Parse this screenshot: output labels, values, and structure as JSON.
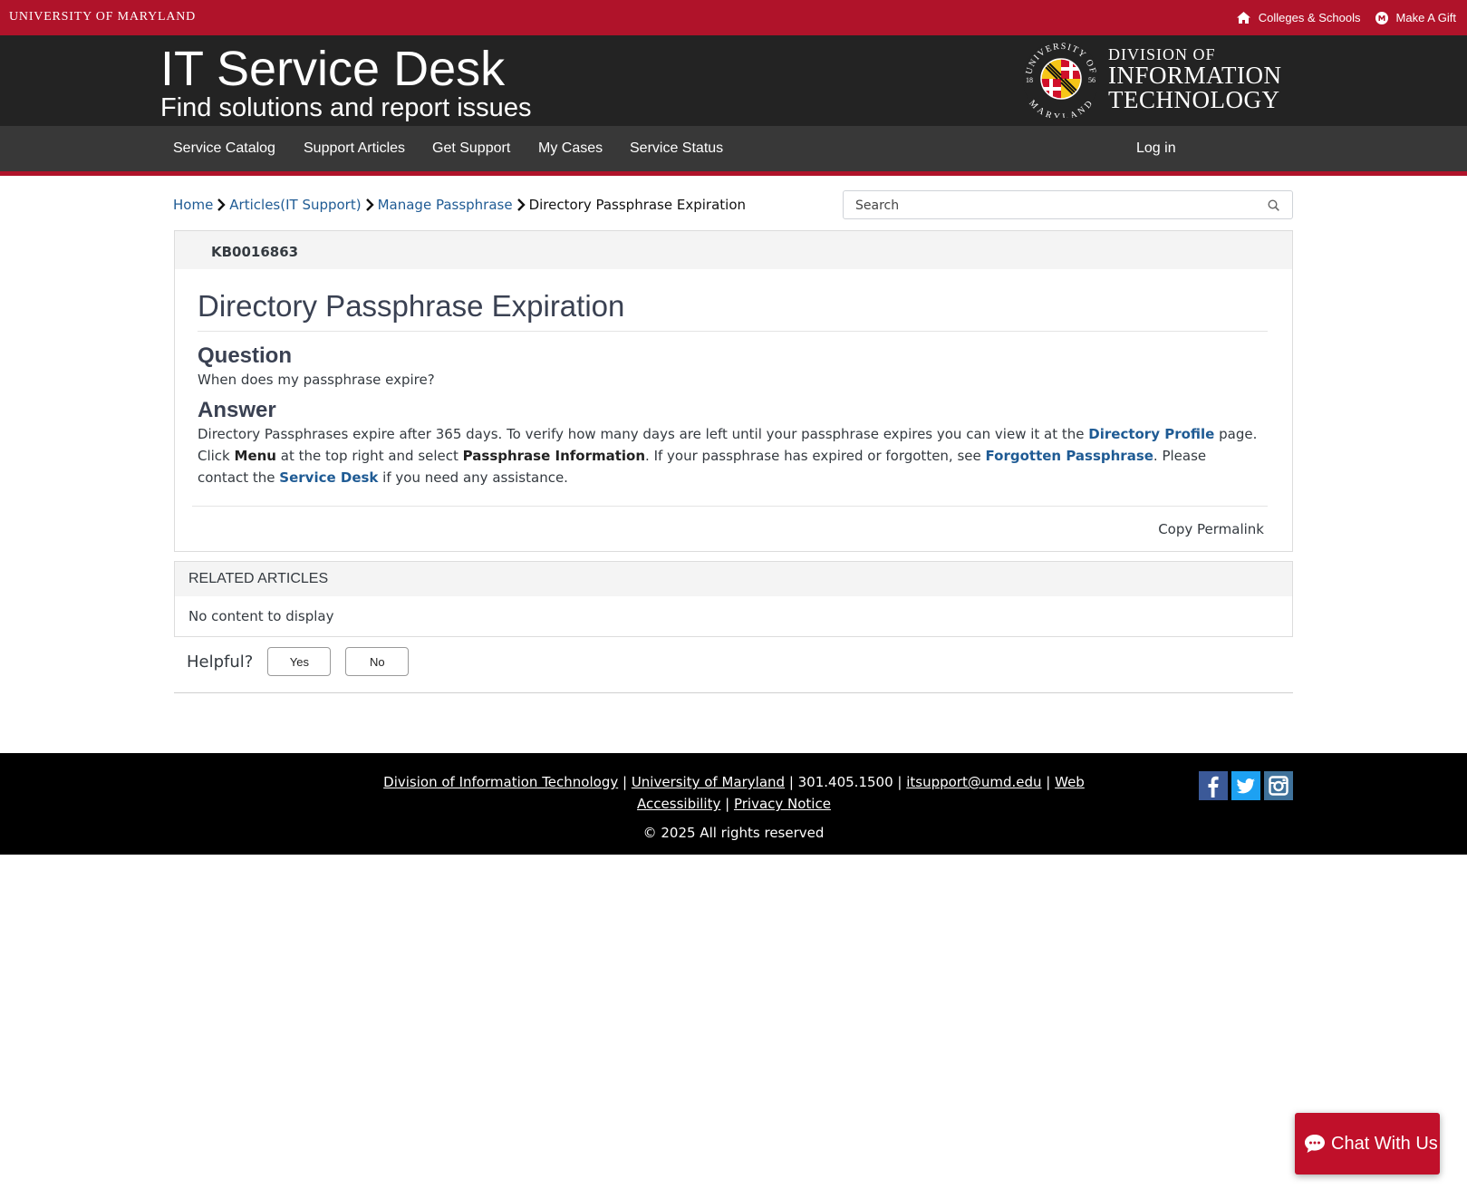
{
  "umd_bar": {
    "name": "UNIVERSITY OF MARYLAND",
    "links": [
      {
        "label": "Colleges & Schools",
        "icon": "home-icon"
      },
      {
        "label": "Make A Gift",
        "icon": "umd-m-icon"
      }
    ]
  },
  "header": {
    "title": "IT Service Desk",
    "subtitle": "Find solutions and report issues",
    "logo": {
      "seal_text_top": "UNIVERSITY OF",
      "seal_text_bottom": "MARYLAND",
      "seal_year_left": "18",
      "seal_year_right": "56",
      "line1": "DIVISION OF",
      "line2": "INFORMATION",
      "line3": "TECHNOLOGY"
    }
  },
  "nav": {
    "items": [
      "Service Catalog",
      "Support Articles",
      "Get Support",
      "My Cases",
      "Service Status"
    ],
    "login": "Log in"
  },
  "breadcrumb": {
    "items": [
      "Home",
      "Articles(IT Support)",
      "Manage Passphrase"
    ],
    "current": "Directory Passphrase Expiration"
  },
  "search": {
    "placeholder": "Search"
  },
  "article": {
    "number": "KB0016863",
    "title": "Directory Passphrase Expiration",
    "question_heading": "Question",
    "question": "When does my passphrase expire?",
    "answer_heading": "Answer",
    "answer": {
      "t1": "Directory Passphrases expire after 365 days. To verify how many days are left until your passphrase expires you can view it at the ",
      "link1": "Directory Profile",
      "t2": " page. Click ",
      "b1": "Menu",
      "t3": " at the top right and select ",
      "b2": "Passphrase Information",
      "t4": ". If your passphrase has expired or forgotten, see ",
      "link2": "Forgotten Passphrase",
      "t5": ". Please contact the ",
      "link3": "Service Desk",
      "t6": " if you need any assistance."
    },
    "permalink": "Copy Permalink"
  },
  "related": {
    "title": "RELATED ARTICLES",
    "empty": "No content to display"
  },
  "helpful": {
    "label": "Helpful?",
    "yes": "Yes",
    "no": "No"
  },
  "footer": {
    "link_dit": "Division of Information Technology",
    "link_umd": "University of Maryland",
    "phone": "301.405.1500",
    "email": "itsupport@umd.edu",
    "link_access": "Web Accessibility",
    "link_privacy": "Privacy Notice",
    "copyright": "© 2025 All rights reserved",
    "social": [
      "facebook-icon",
      "twitter-icon",
      "instagram-icon"
    ]
  },
  "chat": {
    "label": "Chat With Us"
  },
  "colors": {
    "umd_red": "#b0132a",
    "header_dark": "#232323",
    "nav_dark": "#383838",
    "link_blue": "#1f5b94",
    "chat_red": "#c0102a"
  }
}
